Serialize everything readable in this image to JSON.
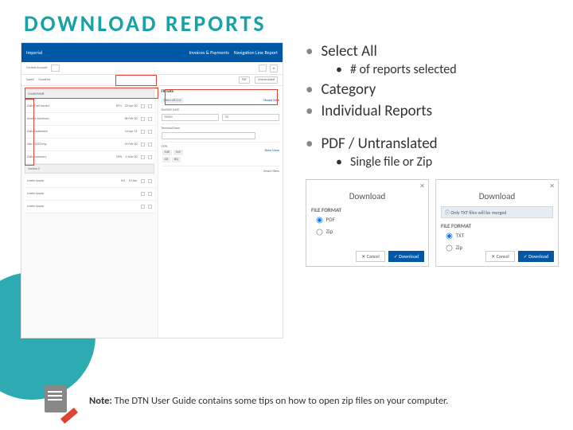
{
  "title": "DOWNLOAD REPORTS",
  "bullets": {
    "b1": "Select All",
    "b1a": "# of reports selected",
    "b2": "Category",
    "b3": "Individual Reports",
    "b4": "PDF / Untranslated",
    "b4a": "Single file or Zip"
  },
  "screenshot": {
    "brand": "Imperial",
    "nav1": "Invoices & Payments",
    "nav2": "Navigation Line Report",
    "crumb": "Current Account",
    "tab1": "Saved",
    "tab2": "Favorites",
    "pdf": "PDF",
    "untrans": "Untranslated",
    "filters": "FILTERS",
    "f_selectall": "Select All (14)",
    "f_sharedwith": "Shared With",
    "invoice_date": "INVOICE DATE",
    "from": "FROM",
    "to": "TO",
    "terminal_zone": "Terminal/Zone",
    "cat_credit": "Credit/Rebill",
    "cat_sec": "Section 2"
  },
  "popup1": {
    "title": "Download",
    "section": "FILE FORMAT",
    "opt1": "PDF",
    "opt2": "Zip",
    "cancel": "Cancel",
    "confirm": "Download"
  },
  "popup2": {
    "title": "Download",
    "msg": "Only TXT files will be merged",
    "section": "FILE FORMAT",
    "opt1": "TXT",
    "opt2": "Zip",
    "cancel": "Cancel",
    "confirm": "Download"
  },
  "note": {
    "bold": "Note:",
    "text": " The DTN User Guide contains some tips on how to  open zip files on your computer."
  }
}
